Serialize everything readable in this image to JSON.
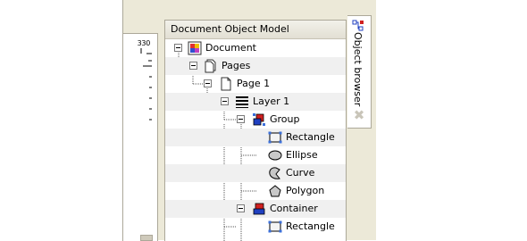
{
  "ruler": {
    "number": "330"
  },
  "dom_panel": {
    "title": "Document Object Model",
    "nodes": [
      {
        "label": "Document",
        "icon": "document-icon"
      },
      {
        "label": "Pages",
        "icon": "pages-icon"
      },
      {
        "label": "Page 1",
        "icon": "page-icon"
      },
      {
        "label": "Layer 1",
        "icon": "layer-icon"
      },
      {
        "label": "Group",
        "icon": "group-icon"
      },
      {
        "label": "Rectangle",
        "icon": "rectangle-icon"
      },
      {
        "label": "Ellipse",
        "icon": "ellipse-icon"
      },
      {
        "label": "Curve",
        "icon": "curve-icon"
      },
      {
        "label": "Polygon",
        "icon": "polygon-icon"
      },
      {
        "label": "Container",
        "icon": "container-icon"
      },
      {
        "label": "Rectangle",
        "icon": "rectangle-icon"
      }
    ]
  },
  "side_tab": {
    "label": "Object browser",
    "close_icon": "close-icon"
  },
  "colors": {
    "chrome": "#ece9d8",
    "border": "#aca899",
    "alt_row": "#f0f0f0"
  }
}
